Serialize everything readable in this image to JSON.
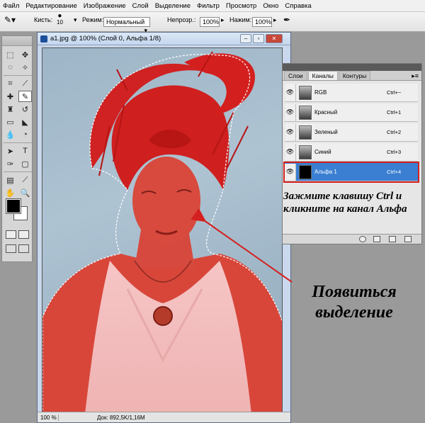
{
  "menubar": [
    "Файл",
    "Редактирование",
    "Изображение",
    "Слой",
    "Выделение",
    "Фильтр",
    "Просмотр",
    "Окно",
    "Справка"
  ],
  "options": {
    "brush_label": "Кисть:",
    "brush_size": "10",
    "mode_label": "Режим:",
    "mode_value": "Нормальный",
    "opacity_label": "Непрозр.:",
    "opacity_value": "100%",
    "flow_label": "Нажим:",
    "flow_value": "100%"
  },
  "document": {
    "title": "a1.jpg @ 100% (Слой 0, Альфа 1/8)",
    "zoom": "100 %",
    "info": "Док: 892,5K/1,16M"
  },
  "panel": {
    "tabs": [
      "Слои",
      "Каналы",
      "Контуры"
    ],
    "channels": [
      {
        "name": "RGB",
        "shortcut": "Ctrl+~"
      },
      {
        "name": "Красный",
        "shortcut": "Ctrl+1"
      },
      {
        "name": "Зеленый",
        "shortcut": "Ctrl+2"
      },
      {
        "name": "Синий",
        "shortcut": "Ctrl+3"
      },
      {
        "name": "Альфа 1",
        "shortcut": "Ctrl+4"
      }
    ]
  },
  "annotations": {
    "instruction": "Зажмите клавишу Ctrl и кликните на канал Альфа",
    "result": "Появиться выделение"
  },
  "colors": {
    "overlay_red": "#d91e1e",
    "selected_channel": "#3a7fd2",
    "highlight_border": "#d32020"
  }
}
